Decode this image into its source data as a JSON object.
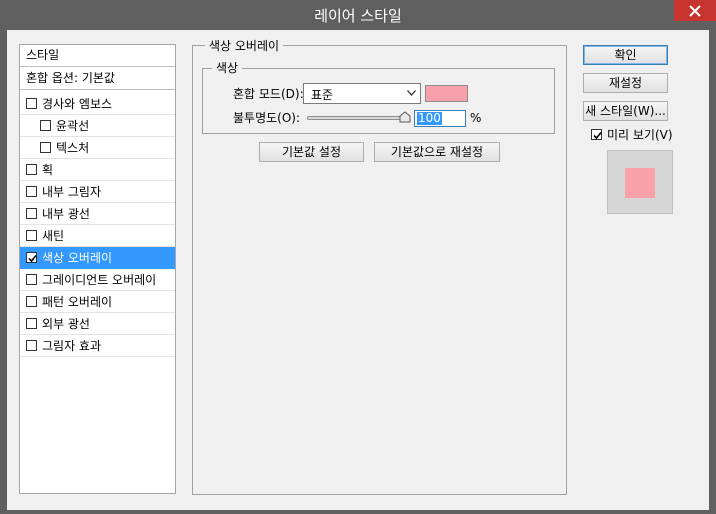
{
  "window": {
    "title": "레이어 스타일"
  },
  "style_list": {
    "header_styles": "스타일",
    "header_blending": "혼합 옵션: 기본값",
    "items": [
      {
        "label": "경사와 엠보스",
        "checked": false
      },
      {
        "label": "윤곽선",
        "checked": false
      },
      {
        "label": "텍스처",
        "checked": false
      },
      {
        "label": "획",
        "checked": false
      },
      {
        "label": "내부 그림자",
        "checked": false
      },
      {
        "label": "내부 광선",
        "checked": false
      },
      {
        "label": "새틴",
        "checked": false
      },
      {
        "label": "색상 오버레이",
        "checked": true
      },
      {
        "label": "그레이디언트 오버레이",
        "checked": false
      },
      {
        "label": "패턴 오버레이",
        "checked": false
      },
      {
        "label": "외부 광선",
        "checked": false
      },
      {
        "label": "그림자 효과",
        "checked": false
      }
    ]
  },
  "panel": {
    "title": "색상 오버레이",
    "group_title": "색상",
    "blend_mode_label": "혼합 모드(D):",
    "blend_mode_value": "표준",
    "overlay_color": "#f8a1ab",
    "opacity_label": "불투명도(O):",
    "opacity_value": "100",
    "opacity_unit": "%",
    "make_default_button": "기본값 설정",
    "reset_default_button": "기본값으로 재설정"
  },
  "actions": {
    "ok_button": "확인",
    "reset_button": "재설정",
    "new_style_button": "새 스타일(W)...",
    "preview_label": "미리 보기(V)",
    "preview_checked": true
  }
}
